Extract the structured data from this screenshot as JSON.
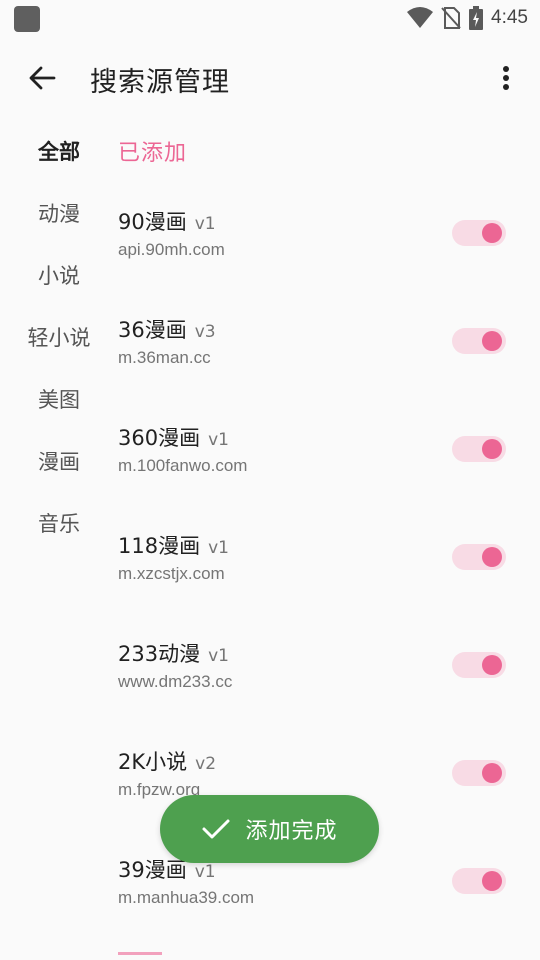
{
  "status_bar": {
    "time": "4:45",
    "icons": [
      "wifi-icon",
      "no-sim-icon",
      "battery-charging-icon"
    ]
  },
  "toolbar": {
    "title": "搜索源管理",
    "back_icon": "arrow-back-icon",
    "more_icon": "more-vert-icon"
  },
  "sidebar": {
    "items": [
      {
        "label": "全部",
        "active": true
      },
      {
        "label": "动漫",
        "active": false
      },
      {
        "label": "小说",
        "active": false
      },
      {
        "label": "轻小说",
        "active": false
      },
      {
        "label": "美图",
        "active": false
      },
      {
        "label": "漫画",
        "active": false
      },
      {
        "label": "音乐",
        "active": false
      }
    ]
  },
  "section": {
    "title": "已添加"
  },
  "sources": [
    {
      "name": "90漫画",
      "version": "v1",
      "host": "api.90mh.com",
      "enabled": true
    },
    {
      "name": "36漫画",
      "version": "v3",
      "host": "m.36man.cc",
      "enabled": true
    },
    {
      "name": "360漫画",
      "version": "v1",
      "host": "m.100fanwo.com",
      "enabled": true
    },
    {
      "name": "118漫画",
      "version": "v1",
      "host": "m.xzcstjx.com",
      "enabled": true
    },
    {
      "name": "233动漫",
      "version": "v1",
      "host": "www.dm233.cc",
      "enabled": true
    },
    {
      "name": "2K小说",
      "version": "v2",
      "host": "m.fpzw.org",
      "enabled": true
    },
    {
      "name": "39漫画",
      "version": "v1",
      "host": "m.manhua39.com",
      "enabled": true
    }
  ],
  "toast": {
    "text": "添加完成",
    "icon": "check-icon"
  },
  "colors": {
    "accent": "#ec6694",
    "switch_track": "#f8dbe5",
    "toast_bg": "#4ea04f"
  }
}
